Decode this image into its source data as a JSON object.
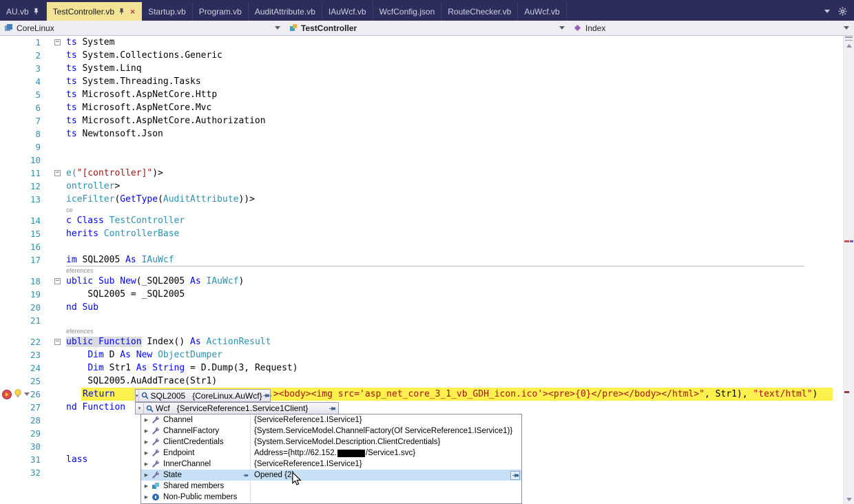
{
  "colors": {
    "tabbar_bg": "#2D2D5C",
    "active_tab_bg": "#F3E396",
    "navbar_bg": "#EEEEF2",
    "keyword": "#0000FF",
    "type": "#2B91AF",
    "string": "#A31515",
    "line_number": "#2B91AF",
    "current_statement_bg": "#FBF04D",
    "selection_bg": "#C8E0F5",
    "breakpoint_red": "#DD3C42"
  },
  "icons": {
    "pin-icon": "pushpin",
    "close-icon": "x",
    "chevron-down-icon": "triangle-down",
    "gear-icon": "gear",
    "magnifier-icon": "magnifier",
    "expander-icon": "triangle-right",
    "property-wrench-icon": "wrench",
    "shared-members-icon": "shared",
    "non-public-members-icon": "lock-sphere",
    "breakpoint-current-icon": "red-circle-yellow-arrow",
    "lightbulb-icon": "bulb",
    "fold-collapse-icon": "minus-box"
  },
  "tabs": {
    "items": [
      {
        "label": "AU.vb",
        "pinned": true
      },
      {
        "label": "TestController.vb",
        "pinned": true,
        "active": true,
        "closable": true
      },
      {
        "label": "Startup.vb"
      },
      {
        "label": "Program.vb"
      },
      {
        "label": "AuditAttribute.vb"
      },
      {
        "label": "IAuWcf.vb"
      },
      {
        "label": "WcfConfig.json"
      },
      {
        "label": "RouteChecker.vb"
      },
      {
        "label": "AuWcf.vb"
      }
    ]
  },
  "navbar": {
    "project": "CoreLinux",
    "type": "TestController",
    "member": "Index"
  },
  "editor": {
    "rows": [
      {
        "t": "line",
        "num": 1,
        "fold": true,
        "segs": [
          [
            "k",
            "ts"
          ],
          [
            "n",
            " System"
          ]
        ]
      },
      {
        "t": "line",
        "num": 2,
        "segs": [
          [
            "k",
            "ts"
          ],
          [
            "n",
            " System.Collections.Generic"
          ]
        ]
      },
      {
        "t": "line",
        "num": 3,
        "segs": [
          [
            "k",
            "ts"
          ],
          [
            "n",
            " System.Linq"
          ]
        ]
      },
      {
        "t": "line",
        "num": 4,
        "segs": [
          [
            "k",
            "ts"
          ],
          [
            "n",
            " System.Threading.Tasks"
          ]
        ]
      },
      {
        "t": "line",
        "num": 5,
        "segs": [
          [
            "k",
            "ts"
          ],
          [
            "n",
            " Microsoft.AspNetCore.Http"
          ]
        ]
      },
      {
        "t": "line",
        "num": 6,
        "segs": [
          [
            "k",
            "ts"
          ],
          [
            "n",
            " Microsoft.AspNetCore.Mvc"
          ]
        ]
      },
      {
        "t": "line",
        "num": 7,
        "segs": [
          [
            "k",
            "ts"
          ],
          [
            "n",
            " Microsoft.AspNetCore.Authorization"
          ]
        ]
      },
      {
        "t": "line",
        "num": 8,
        "segs": [
          [
            "k",
            "ts"
          ],
          [
            "n",
            " Newtonsoft.Json"
          ]
        ]
      },
      {
        "t": "line",
        "num": 9,
        "segs": []
      },
      {
        "t": "line",
        "num": 10,
        "segs": []
      },
      {
        "t": "line",
        "num": 11,
        "fold": true,
        "segs": [
          [
            "t",
            "e("
          ],
          [
            "s",
            "\"[controller]\""
          ],
          [
            "n",
            ")>"
          ]
        ]
      },
      {
        "t": "line",
        "num": 12,
        "segs": [
          [
            "t",
            "ontroller"
          ],
          [
            "n",
            ">"
          ]
        ]
      },
      {
        "t": "line",
        "num": 13,
        "segs": [
          [
            "t",
            "iceFilter"
          ],
          [
            "n",
            "("
          ],
          [
            "k",
            "GetType"
          ],
          [
            "n",
            "("
          ],
          [
            "t",
            "AuditAttribute"
          ],
          [
            "n",
            "))>"
          ]
        ]
      },
      {
        "t": "lens",
        "text": "ce"
      },
      {
        "t": "line",
        "num": 14,
        "segs": [
          [
            "k",
            "c "
          ],
          [
            "k",
            "Class"
          ],
          [
            "n",
            " "
          ],
          [
            "t",
            "TestController"
          ]
        ]
      },
      {
        "t": "line",
        "num": 15,
        "segs": [
          [
            "k",
            "herits"
          ],
          [
            "n",
            " "
          ],
          [
            "t",
            "ControllerBase"
          ]
        ]
      },
      {
        "t": "line",
        "num": 16,
        "segs": []
      },
      {
        "t": "line",
        "num": 17,
        "underline": true,
        "segs": [
          [
            "k",
            "im"
          ],
          [
            "n",
            " SQL2005 "
          ],
          [
            "k",
            "As"
          ],
          [
            "n",
            " "
          ],
          [
            "t",
            "IAuWcf"
          ]
        ]
      },
      {
        "t": "lens",
        "text": "eferences"
      },
      {
        "t": "line",
        "num": 18,
        "fold": true,
        "segs": [
          [
            "k",
            "ublic Sub New"
          ],
          [
            "n",
            "(_SQL2005 "
          ],
          [
            "k",
            "As"
          ],
          [
            "n",
            " "
          ],
          [
            "t",
            "IAuWcf"
          ],
          [
            "n",
            ")"
          ]
        ]
      },
      {
        "t": "line",
        "num": 19,
        "segs": [
          [
            "n",
            "    SQL2005 = _SQL2005"
          ]
        ]
      },
      {
        "t": "line",
        "num": 20,
        "segs": [
          [
            "k",
            "nd Sub"
          ]
        ]
      },
      {
        "t": "line",
        "num": 21,
        "segs": []
      },
      {
        "t": "lens",
        "text": "eferences"
      },
      {
        "t": "line",
        "num": 22,
        "fold": true,
        "segs": [
          [
            "k hl",
            "ublic Function"
          ],
          [
            "n",
            " Index() "
          ],
          [
            "k",
            "As"
          ],
          [
            "n",
            " "
          ],
          [
            "t",
            "ActionResult"
          ]
        ]
      },
      {
        "t": "line",
        "num": 23,
        "segs": [
          [
            "n",
            "    "
          ],
          [
            "k",
            "Dim"
          ],
          [
            "n",
            " D "
          ],
          [
            "k",
            "As New"
          ],
          [
            "n",
            " "
          ],
          [
            "t",
            "ObjectDumper"
          ]
        ]
      },
      {
        "t": "line",
        "num": 24,
        "segs": [
          [
            "n",
            "    "
          ],
          [
            "k",
            "Dim"
          ],
          [
            "n",
            " Str1 "
          ],
          [
            "k",
            "As String"
          ],
          [
            "n",
            " = D.Dump(3, Request)"
          ]
        ]
      },
      {
        "t": "line",
        "num": 25,
        "segs": [
          [
            "n",
            "    SQL2005.AuAddTrace(Str1)"
          ]
        ]
      },
      {
        "t": "line",
        "num": 26,
        "current": true,
        "bp": true,
        "segs": [
          [
            "k",
            "Return"
          ]
        ],
        "frag": [
          [
            "s",
            ".><body><img src='asp_net_core_3_1_vb_GDH_icon.ico'><pre>{0}</pre></body></html>\""
          ],
          [
            "n",
            ", Str1), "
          ],
          [
            "s",
            "\"text/html\""
          ],
          [
            "n",
            ")"
          ]
        ]
      },
      {
        "t": "line",
        "num": 27,
        "segs": [
          [
            "k",
            "nd Function"
          ]
        ]
      },
      {
        "t": "line",
        "num": 28,
        "segs": []
      },
      {
        "t": "line",
        "num": 29,
        "segs": []
      },
      {
        "t": "line",
        "num": 30,
        "segs": []
      },
      {
        "t": "line",
        "num": 31,
        "segs": [
          [
            "k",
            "lass"
          ]
        ]
      },
      {
        "t": "line",
        "num": 32,
        "segs": []
      }
    ]
  },
  "datatip": {
    "root": {
      "name": "SQL2005",
      "value": "{CoreLinux.AuWcf}"
    },
    "child": {
      "name": "Wcf",
      "value": "{ServiceReference1.Service1Client}"
    },
    "members": [
      {
        "name": "Channel",
        "value": "{ServiceReference1.IService1}"
      },
      {
        "name": "ChannelFactory",
        "value": "{System.ServiceModel.ChannelFactory(Of ServiceReference1.IService1)}"
      },
      {
        "name": "ClientCredentials",
        "value": "{System.ServiceModel.Description.ClientCredentials}"
      },
      {
        "name": "Endpoint",
        "value": "Address={http://62.152.",
        "redacted": true,
        "value2": "/Service1.svc}"
      },
      {
        "name": "InnerChannel",
        "value": "{ServiceReference1.IService1}"
      },
      {
        "name": "State",
        "value": "Opened {2}",
        "selected": true,
        "pinned": true
      },
      {
        "name": "Shared members",
        "value": "",
        "kind": "shared"
      },
      {
        "name": "Non-Public members",
        "value": "",
        "kind": "nonpublic"
      }
    ]
  }
}
